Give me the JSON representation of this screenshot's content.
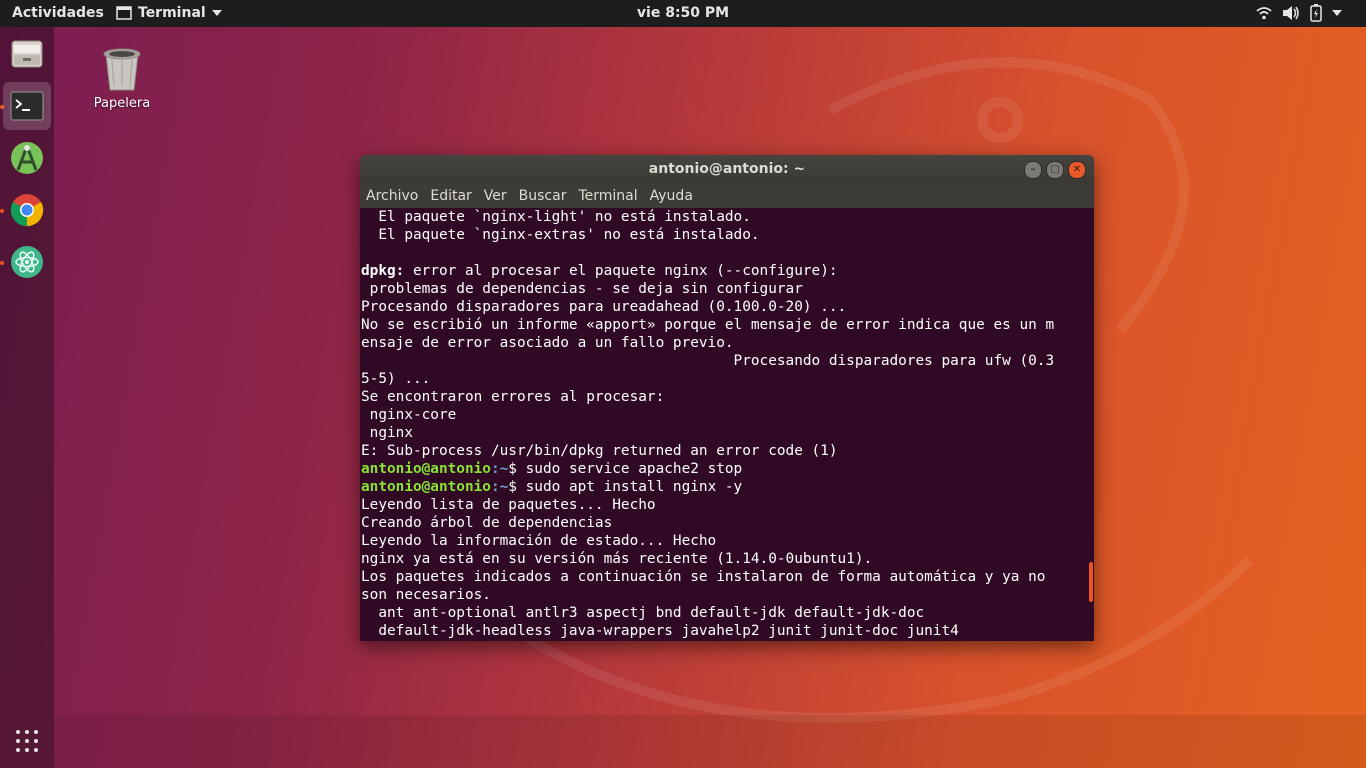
{
  "topbar": {
    "activities": "Actividades",
    "app_name": "Terminal",
    "clock": "vie  8:50 PM"
  },
  "desktop": {
    "trash_label": "Papelera"
  },
  "window": {
    "title": "antonio@antonio: ~",
    "menu": [
      "Archivo",
      "Editar",
      "Ver",
      "Buscar",
      "Terminal",
      "Ayuda"
    ]
  },
  "terminal": {
    "lines": [
      {
        "text": "  El paquete `nginx-light' no está instalado."
      },
      {
        "text": "  El paquete `nginx-extras' no está instalado."
      },
      {
        "text": ""
      },
      {
        "bold": "dpkg:",
        "text": " error al procesar el paquete nginx (--configure):"
      },
      {
        "text": " problemas de dependencias - se deja sin configurar"
      },
      {
        "text": "Procesando disparadores para ureadahead (0.100.0-20) ..."
      },
      {
        "text": "No se escribió un informe «apport» porque el mensaje de error indica que es un m"
      },
      {
        "text": "ensaje de error asociado a un fallo previo."
      },
      {
        "text": "                                           Procesando disparadores para ufw (0.3"
      },
      {
        "text": "5-5) ..."
      },
      {
        "text": "Se encontraron errores al procesar:"
      },
      {
        "text": " nginx-core"
      },
      {
        "text": " nginx"
      },
      {
        "text": "E: Sub-process /usr/bin/dpkg returned an error code (1)"
      },
      {
        "prompt": "antonio@antonio",
        "path": ":~",
        "text": "$ sudo service apache2 stop"
      },
      {
        "prompt": "antonio@antonio",
        "path": ":~",
        "text": "$ sudo apt install nginx -y"
      },
      {
        "text": "Leyendo lista de paquetes... Hecho"
      },
      {
        "text": "Creando árbol de dependencias"
      },
      {
        "text": "Leyendo la información de estado... Hecho"
      },
      {
        "text": "nginx ya está en su versión más reciente (1.14.0-0ubuntu1)."
      },
      {
        "text": "Los paquetes indicados a continuación se instalaron de forma automática y ya no"
      },
      {
        "text": "son necesarios."
      },
      {
        "text": "  ant ant-optional antlr3 aspectj bnd default-jdk default-jdk-doc"
      },
      {
        "text": "  default-jdk-headless java-wrappers javahelp2 junit junit-doc junit4"
      }
    ]
  },
  "colors": {
    "terminal_bg": "#300a24",
    "prompt_green": "#8ae234",
    "path_blue": "#729fcf",
    "ubuntu_orange": "#e95420"
  },
  "icons": {
    "dock": [
      "files-icon",
      "terminal-icon",
      "android-studio-icon",
      "chrome-icon",
      "atom-icon"
    ],
    "tray": [
      "wifi-icon",
      "volume-icon",
      "battery-icon",
      "chevron-down-icon"
    ],
    "apps_grid": "show-applications-icon"
  }
}
